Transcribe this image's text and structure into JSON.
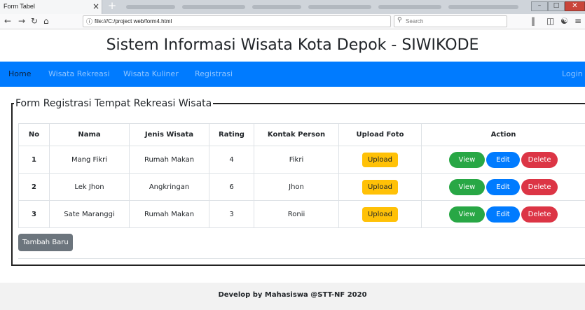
{
  "browser": {
    "tab_title": "Form Tabel",
    "tab_close": "×",
    "new_tab": "+",
    "url": "file:///C:/project web/form4.html",
    "search_placeholder": "Search"
  },
  "page": {
    "title": "Sistem Informasi Wisata Kota Depok - SIWIKODE"
  },
  "nav": {
    "items": [
      {
        "label": "Home"
      },
      {
        "label": "Wisata Rekreasi"
      },
      {
        "label": "Wisata Kuliner"
      },
      {
        "label": "Registrasi"
      }
    ],
    "login": "Login",
    "accent_color": "#007bff"
  },
  "form": {
    "legend": "Form Registrasi Tempat Rekreasi Wisata",
    "headers": [
      "No",
      "Nama",
      "Jenis Wisata",
      "Rating",
      "Kontak Person",
      "Upload Foto",
      "Action"
    ],
    "rows": [
      {
        "no": "1",
        "nama": "Mang Fikri",
        "jenis": "Rumah Makan",
        "rating": "4",
        "kontak": "Fikri"
      },
      {
        "no": "2",
        "nama": "Lek Jhon",
        "jenis": "Angkringan",
        "rating": "6",
        "kontak": "Jhon"
      },
      {
        "no": "3",
        "nama": "Sate Maranggi",
        "jenis": "Rumah Makan",
        "rating": "3",
        "kontak": "Ronii"
      }
    ],
    "upload_label": "Upload",
    "view_label": "View",
    "edit_label": "Edit",
    "delete_label": "Delete",
    "add_label": "Tambah Baru"
  },
  "footer": {
    "text": "Develop by Mahasiswa @STT-NF 2020"
  }
}
